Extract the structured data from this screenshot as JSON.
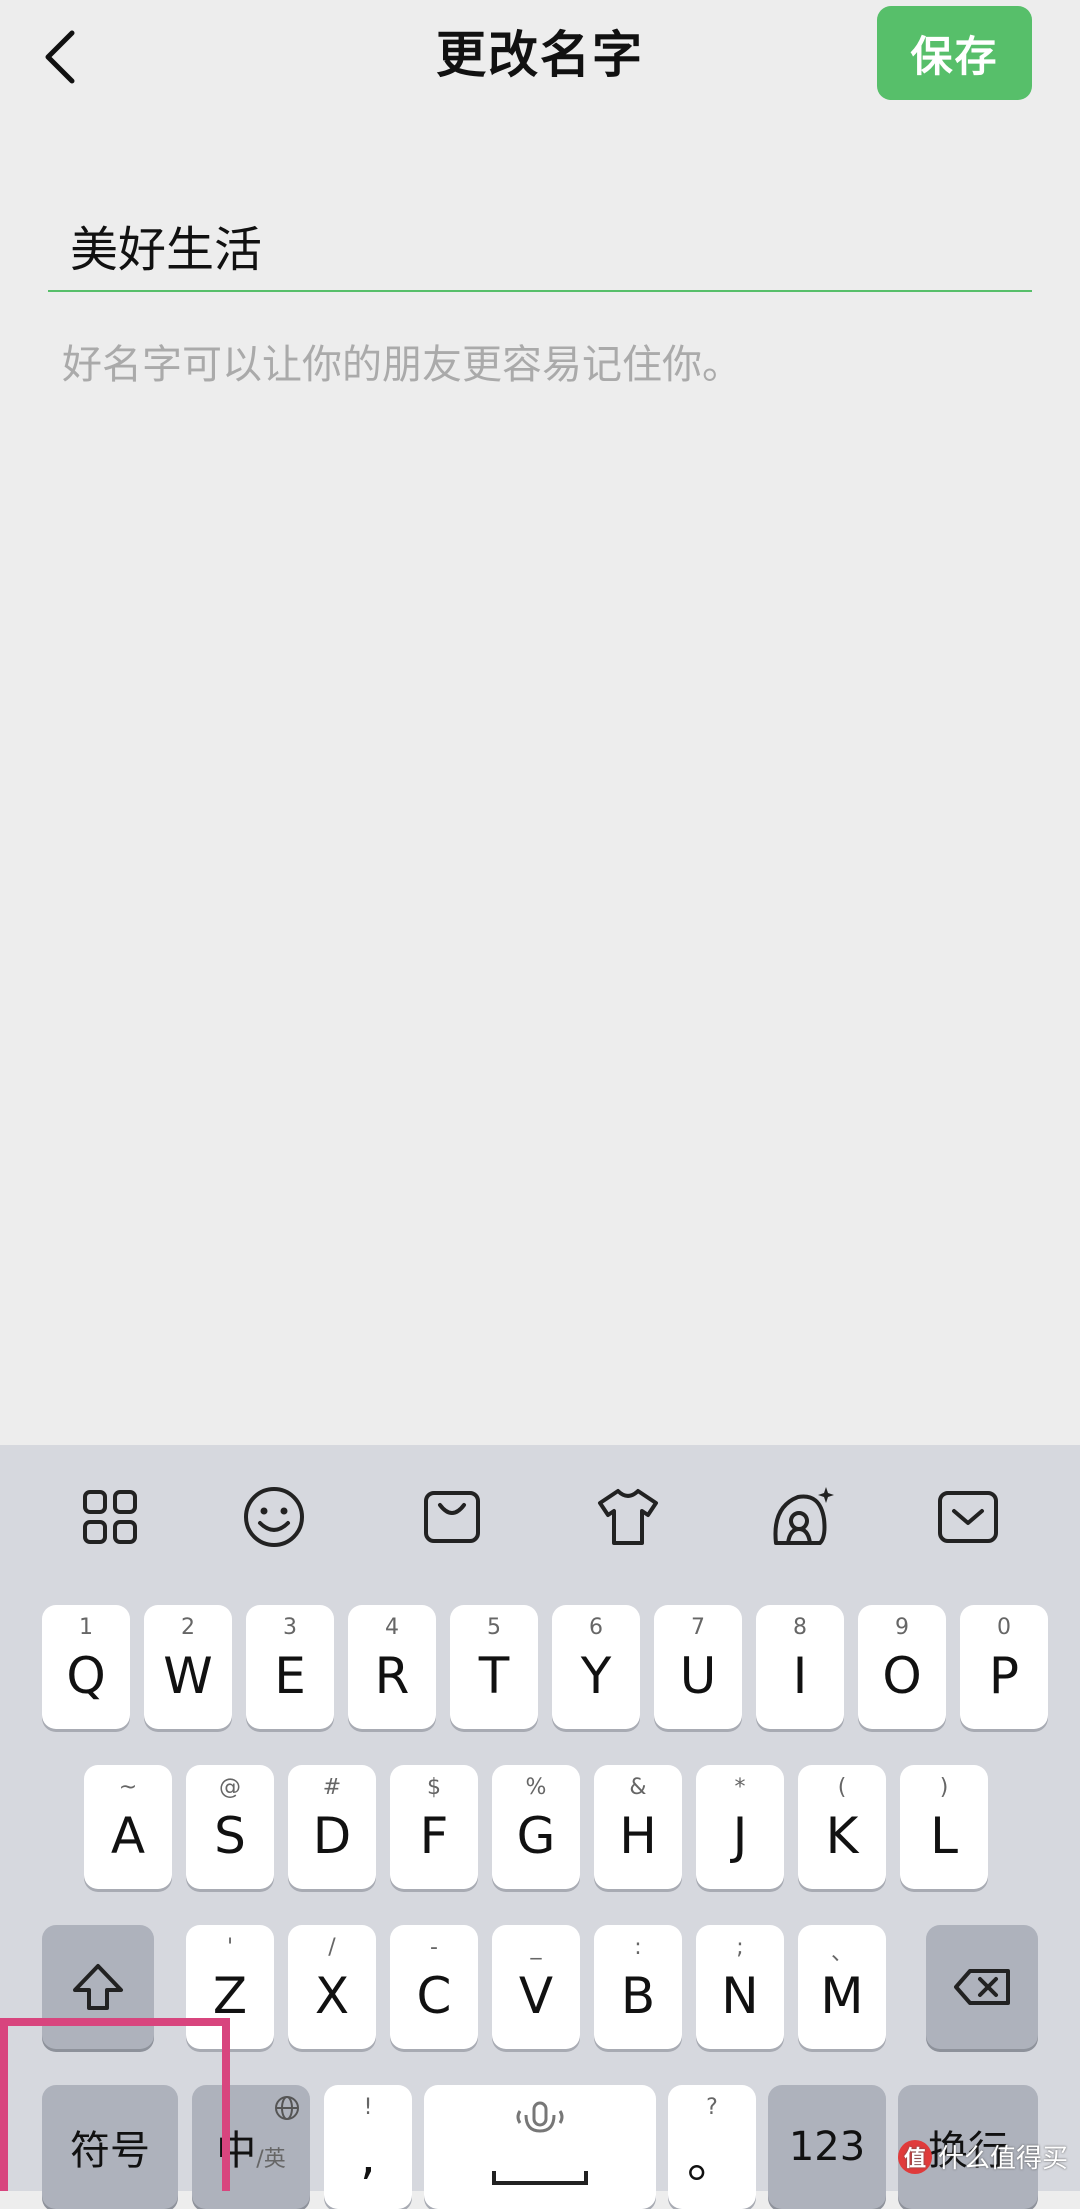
{
  "header": {
    "title": "更改名字",
    "save_label": "保存"
  },
  "name_field": {
    "value": "美好生活"
  },
  "hint": "好名字可以让你的朋友更容易记住你。",
  "toolbar_icons": [
    "grid-icon",
    "smiley-icon",
    "bag-icon",
    "tshirt-icon",
    "avatar-sparkle-icon",
    "keyboard-collapse-icon"
  ],
  "keyboard": {
    "row1": [
      {
        "hint": "1",
        "char": "Q"
      },
      {
        "hint": "2",
        "char": "W"
      },
      {
        "hint": "3",
        "char": "E"
      },
      {
        "hint": "4",
        "char": "R"
      },
      {
        "hint": "5",
        "char": "T"
      },
      {
        "hint": "6",
        "char": "Y"
      },
      {
        "hint": "7",
        "char": "U"
      },
      {
        "hint": "8",
        "char": "I"
      },
      {
        "hint": "9",
        "char": "O"
      },
      {
        "hint": "0",
        "char": "P"
      }
    ],
    "row2": [
      {
        "hint": "~",
        "char": "A"
      },
      {
        "hint": "@",
        "char": "S"
      },
      {
        "hint": "#",
        "char": "D"
      },
      {
        "hint": "$",
        "char": "F"
      },
      {
        "hint": "%",
        "char": "G"
      },
      {
        "hint": "&",
        "char": "H"
      },
      {
        "hint": "*",
        "char": "J"
      },
      {
        "hint": "(",
        "char": "K"
      },
      {
        "hint": ")",
        "char": "L"
      }
    ],
    "row3": [
      {
        "hint": "'",
        "char": "Z"
      },
      {
        "hint": "/",
        "char": "X"
      },
      {
        "hint": "-",
        "char": "C"
      },
      {
        "hint": "_",
        "char": "V"
      },
      {
        "hint": ":",
        "char": "B"
      },
      {
        "hint": ";",
        "char": "N"
      },
      {
        "hint": "、",
        "char": "M"
      }
    ],
    "symbols_label": "符号",
    "lang_main": "中",
    "lang_sub": "/英",
    "comma_hint": "!",
    "comma_char": ",",
    "period_hint": "?",
    "period_char": "。",
    "num_label": "123",
    "enter_label": "换行"
  },
  "watermark": {
    "badge": "值",
    "text": "什么值得买"
  },
  "colors": {
    "accent": "#57bf6a",
    "highlight": "#d8457e"
  }
}
